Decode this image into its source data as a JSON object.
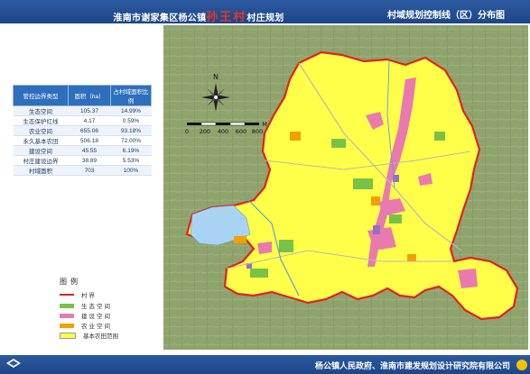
{
  "header": {
    "title_prefix": "淮南市谢家集区杨公镇",
    "village_name": "孙王村",
    "title_suffix": "村庄规划",
    "subtitle": "村域规划控制线（区）分布图"
  },
  "table": {
    "headers": [
      "管控边界类型",
      "面积（ha）",
      "占村域面积比例"
    ],
    "rows": [
      {
        "type": "生态空间",
        "area": "105.37",
        "ratio": "14.99%"
      },
      {
        "type": "生态保护红线",
        "area": "4.17",
        "ratio": "0.59%"
      },
      {
        "type": "农业空间",
        "area": "655.06",
        "ratio": "93.18%"
      },
      {
        "type": "永久基本农田",
        "area": "506.18",
        "ratio": "72.00%"
      },
      {
        "type": "建设空间",
        "area": "45.55",
        "ratio": "6.19%"
      },
      {
        "type": "村庄建设边界",
        "area": "38.89",
        "ratio": "5.53%"
      },
      {
        "type": "村域面积",
        "area": "703",
        "ratio": "100%"
      }
    ]
  },
  "legend": {
    "title": "图例",
    "items": [
      {
        "label": "村界",
        "color": "#e02222",
        "kind": "line"
      },
      {
        "label": "生态空间",
        "color": "#78c248",
        "kind": "fill"
      },
      {
        "label": "建设空间",
        "color": "#e87ab0",
        "kind": "fill"
      },
      {
        "label": "农业空间",
        "color": "#f2a000",
        "kind": "fill"
      },
      {
        "label": "基本农田范围",
        "color": "#ffff4a",
        "kind": "fill"
      }
    ]
  },
  "map": {
    "north_label": "N",
    "scale_ticks": [
      "0",
      "200",
      "400",
      "600",
      "800"
    ],
    "scale_unit": "M"
  },
  "footer": {
    "credits": "杨公镇人民政府、淮南市建发规划设计研究院有限公司"
  },
  "colors": {
    "header_blue": "#2c5aa0",
    "boundary_red": "#e02222",
    "farmland_yellow": "#ffff4a",
    "ecological_green": "#78c248",
    "construction_pink": "#e87ab0",
    "water_blue": "#a9d3f2"
  }
}
